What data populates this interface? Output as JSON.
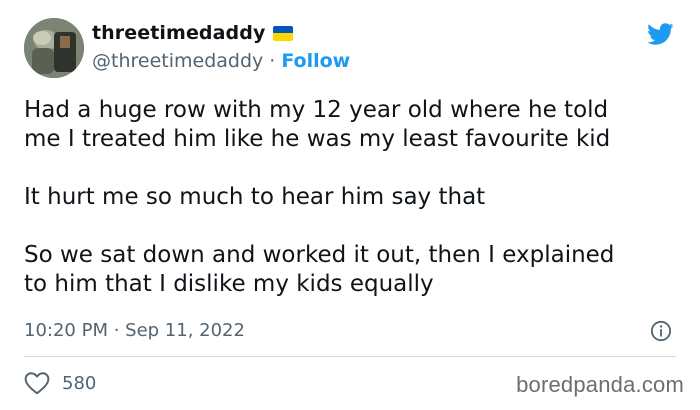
{
  "author": {
    "display_name": "threetimedaddy",
    "handle": "@threetimedaddy",
    "follow_label": "Follow",
    "separator": "·",
    "flag_colors": {
      "top": "#0057b7",
      "bottom": "#ffd700"
    }
  },
  "tweet": {
    "paragraphs": [
      "Had a huge row with my 12 year old where he told\nme I treated him like he was my least favourite kid",
      "It hurt me so much to hear him say that",
      "So we sat down and worked it out, then I explained\nto him that I dislike my kids equally"
    ],
    "timestamp": "10:20 PM · Sep 11, 2022"
  },
  "engagement": {
    "like_count": "580"
  },
  "watermark": "boredpanda.com",
  "icons": {
    "platform": "twitter-bird-icon",
    "info": "info-icon",
    "like": "heart-icon"
  },
  "colors": {
    "accent": "#1d9bf0",
    "text": "#0f1419",
    "secondary": "#536471",
    "divider": "#cfd9de"
  }
}
